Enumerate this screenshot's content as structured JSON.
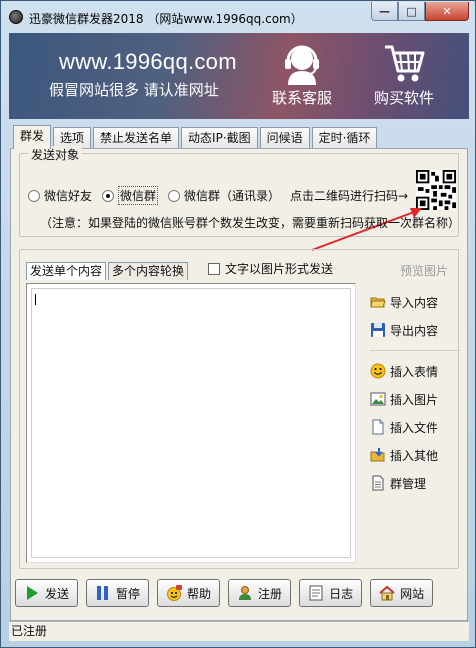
{
  "window": {
    "title": "迅豪微信群发器2018 （网站www.1996qq.com）",
    "controls": {
      "minimize": "—",
      "maximize": "□",
      "close": "✕"
    }
  },
  "banner": {
    "url": "www.1996qq.com",
    "slogan": "假冒网站很多 请认准网址",
    "service_label": "联系客服",
    "buy_label": "购买软件"
  },
  "tabs": [
    {
      "label": "群发",
      "active": true
    },
    {
      "label": "选项"
    },
    {
      "label": "禁止发送名单"
    },
    {
      "label": "动态IP·截图"
    },
    {
      "label": "问候语"
    },
    {
      "label": "定时·循环"
    }
  ],
  "send_target": {
    "legend": "发送对象",
    "options": [
      {
        "label": "微信好友",
        "selected": false
      },
      {
        "label": "微信群",
        "selected": true
      },
      {
        "label": "微信群（通讯录）",
        "selected": false
      }
    ],
    "qr_hint": "点击二维码进行扫码→",
    "notice": "（注意：如果登陆的微信账号群个数发生改变，需要重新扫码获取一次群名称）"
  },
  "content": {
    "subtabs": [
      {
        "label": "发送单个内容",
        "active": true
      },
      {
        "label": "多个内容轮换"
      }
    ],
    "image_mode_label": "文字以图片形式发送",
    "image_mode_checked": false,
    "preview_label": "预览图片",
    "side_actions": [
      {
        "label": "导入内容",
        "icon": "folder-open-icon"
      },
      {
        "label": "导出内容",
        "icon": "floppy-save-icon"
      },
      {
        "label": "插入表情",
        "icon": "smiley-icon"
      },
      {
        "label": "插入图片",
        "icon": "image-icon"
      },
      {
        "label": "插入文件",
        "icon": "file-icon"
      },
      {
        "label": "插入其他",
        "icon": "insert-other-icon"
      },
      {
        "label": "群管理",
        "icon": "document-icon"
      }
    ]
  },
  "bottom_buttons": [
    {
      "label": "发送",
      "icon": "play-icon"
    },
    {
      "label": "暂停",
      "icon": "pause-icon"
    },
    {
      "label": "帮助",
      "icon": "help-smiley-icon"
    },
    {
      "label": "注册",
      "icon": "user-icon"
    },
    {
      "label": "日志",
      "icon": "log-icon"
    },
    {
      "label": "网站",
      "icon": "home-icon"
    }
  ],
  "status": "已注册",
  "colors": {
    "banner_start": "#3c577e",
    "banner_mid": "#8e5565",
    "arrow": "#e0262b",
    "play": "#1f9d35",
    "pause": "#2f63c3"
  }
}
